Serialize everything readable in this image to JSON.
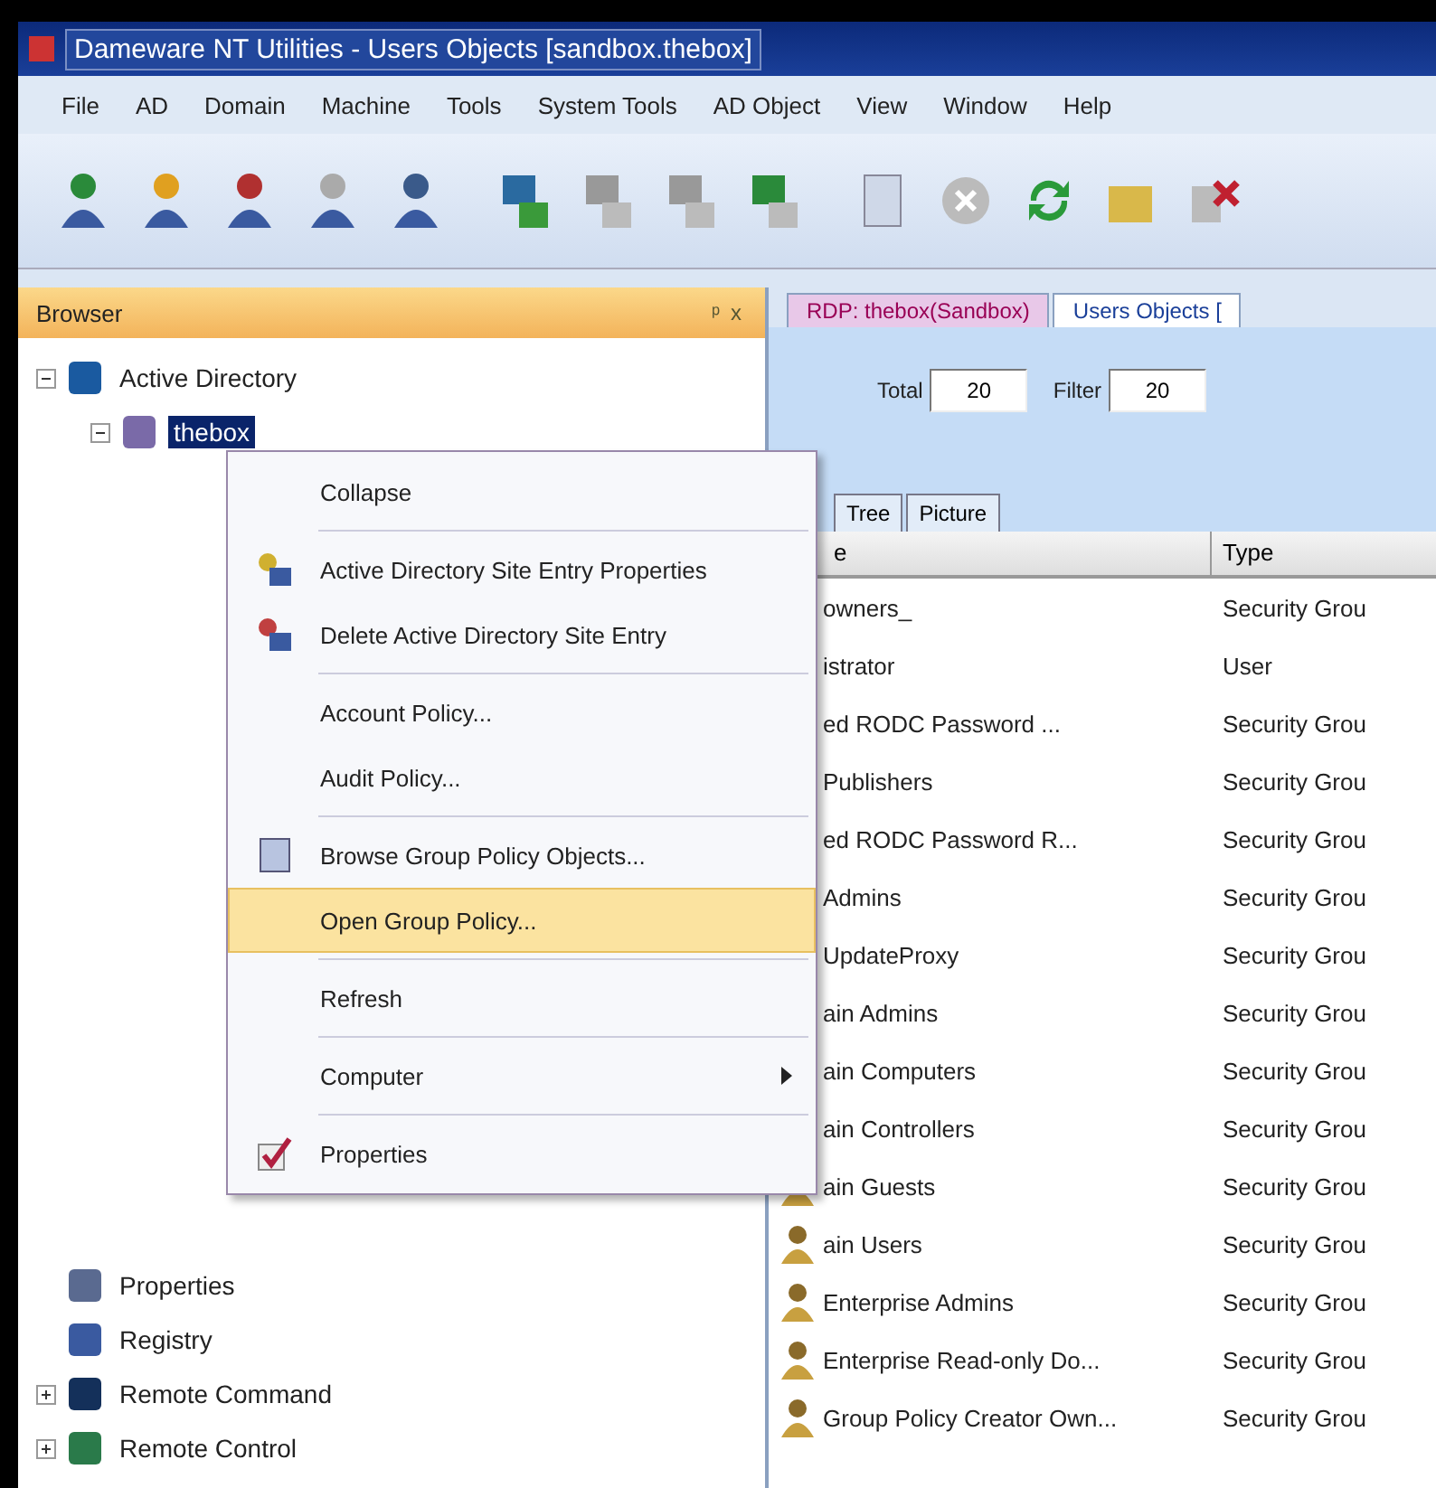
{
  "window": {
    "title": "Dameware NT Utilities - Users Objects [sandbox.thebox]"
  },
  "menu_bar": [
    "File",
    "AD",
    "Domain",
    "Machine",
    "Tools",
    "System Tools",
    "AD Object",
    "View",
    "Window",
    "Help"
  ],
  "browser": {
    "title": "Browser",
    "pin": "ᵖ",
    "close": "x",
    "tree": [
      {
        "label": "Active Directory",
        "expanded": true,
        "selected": false,
        "children": [
          {
            "label": "thebox",
            "selected": true,
            "expanded": true
          }
        ]
      },
      {
        "label": "Properties",
        "selected": false
      },
      {
        "label": "Registry",
        "selected": false
      },
      {
        "label": "Remote Command",
        "selected": false,
        "expanded": false
      },
      {
        "label": "Remote Control",
        "selected": false,
        "expanded": false
      }
    ]
  },
  "document_tabs": [
    {
      "label": "RDP: thebox(Sandbox)",
      "selected": false
    },
    {
      "label": "Users Objects [",
      "selected": true
    }
  ],
  "counts": [
    {
      "label": "Total",
      "value": "20"
    },
    {
      "label": "Filter",
      "value": "20"
    }
  ],
  "view_tabs": [
    {
      "label": "Tree",
      "selected": false
    },
    {
      "label": "Picture",
      "selected": false
    }
  ],
  "table": {
    "columns": [
      "e",
      "Type"
    ],
    "rows": [
      {
        "name": "owners_",
        "type": "Security Grou"
      },
      {
        "name": "istrator",
        "type": "User"
      },
      {
        "name": "ed RODC Password ...",
        "type": "Security Grou"
      },
      {
        "name": "Publishers",
        "type": "Security Grou"
      },
      {
        "name": "ed RODC Password R...",
        "type": "Security Grou"
      },
      {
        "name": "Admins",
        "type": "Security Grou"
      },
      {
        "name": "UpdateProxy",
        "type": "Security Grou"
      },
      {
        "name": "ain Admins",
        "type": "Security Grou"
      },
      {
        "name": "ain Computers",
        "type": "Security Grou"
      },
      {
        "name": "ain Controllers",
        "type": "Security Grou"
      },
      {
        "name": "ain Guests",
        "type": "Security Grou"
      },
      {
        "name": "ain Users",
        "type": "Security Grou"
      },
      {
        "name": "Enterprise Admins",
        "type": "Security Grou"
      },
      {
        "name": "Enterprise Read-only Do...",
        "type": "Security Grou"
      },
      {
        "name": "Group Policy Creator Own...",
        "type": "Security Grou"
      }
    ]
  },
  "context_menu": [
    {
      "label": "Collapse",
      "kind": "item",
      "selected": false
    },
    {
      "kind": "separator"
    },
    {
      "label": "Active Directory Site Entry Properties",
      "kind": "item",
      "selected": false
    },
    {
      "label": "Delete Active Directory Site Entry",
      "kind": "item",
      "selected": false
    },
    {
      "kind": "separator"
    },
    {
      "label": "Account Policy...",
      "kind": "item",
      "selected": false
    },
    {
      "label": "Audit Policy...",
      "kind": "item",
      "selected": false
    },
    {
      "kind": "separator"
    },
    {
      "label": "Browse Group Policy Objects...",
      "kind": "item",
      "selected": false
    },
    {
      "label": "Open Group Policy...",
      "kind": "item",
      "selected": true
    },
    {
      "kind": "separator"
    },
    {
      "label": "Refresh",
      "kind": "item",
      "selected": false
    },
    {
      "kind": "separator"
    },
    {
      "label": "Computer",
      "kind": "submenu",
      "selected": false
    },
    {
      "kind": "separator"
    },
    {
      "label": "Properties",
      "kind": "item",
      "selected": false
    }
  ]
}
